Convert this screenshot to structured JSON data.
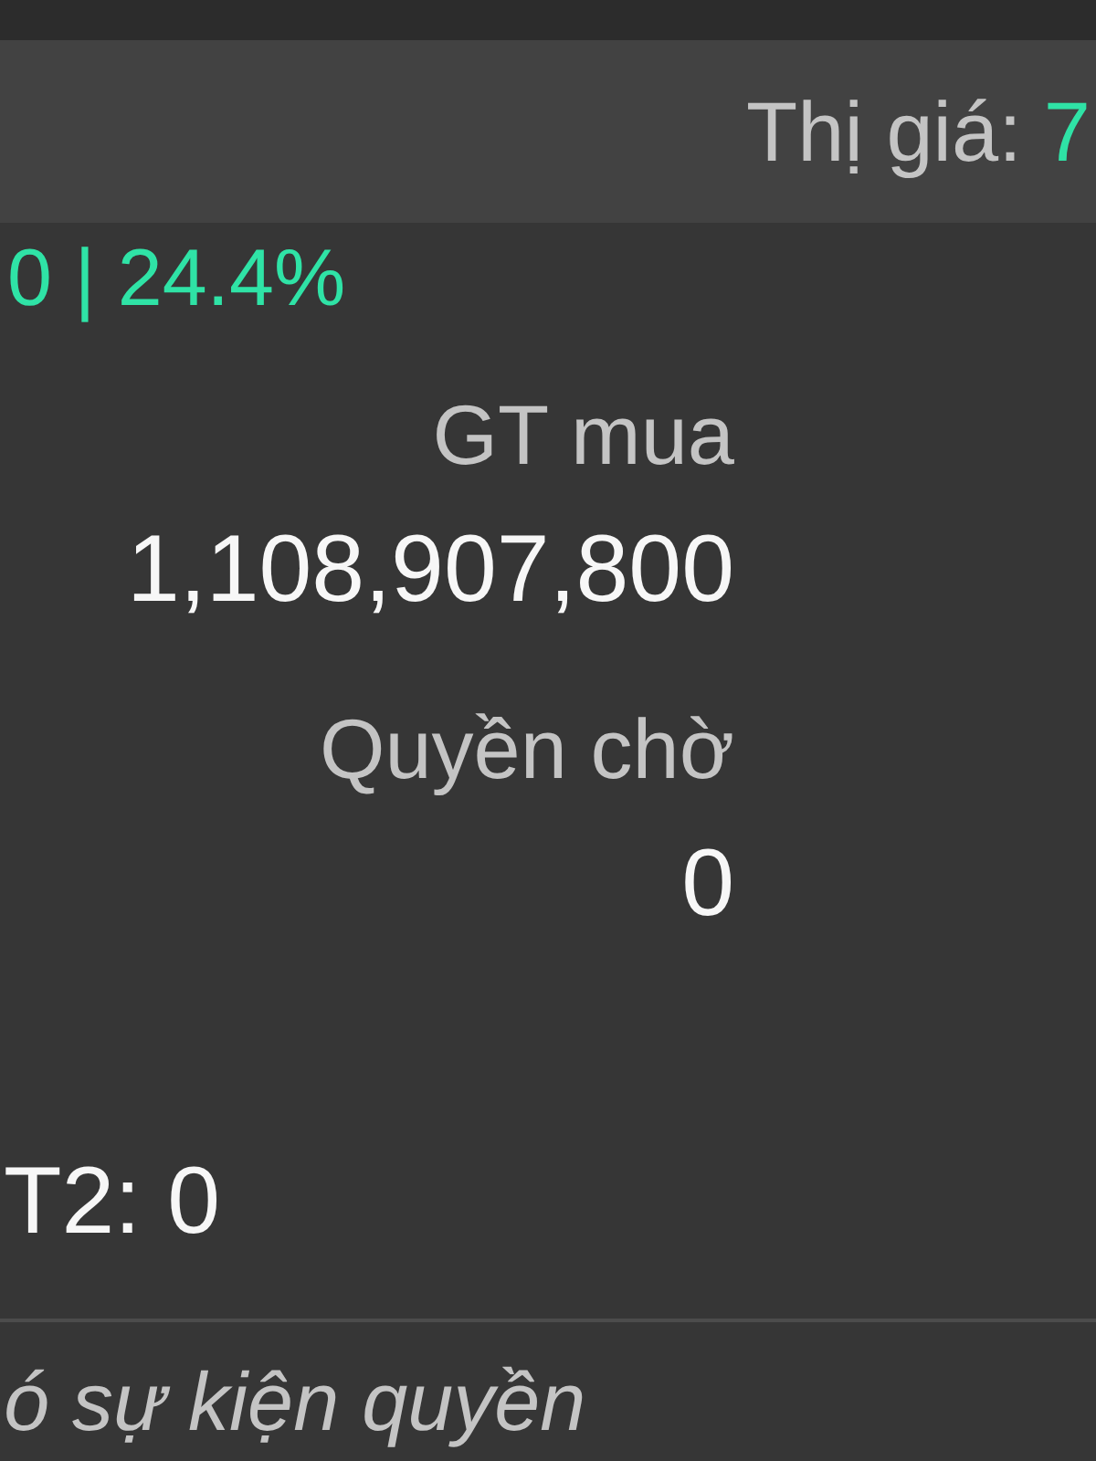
{
  "header": {
    "label": "Thị giá:",
    "value": "7"
  },
  "summary": {
    "text": "0 | 24.4%"
  },
  "stats": [
    {
      "label": "GT mua",
      "value": "1,108,907,800"
    },
    {
      "label": "Quyền chờ",
      "value": "0"
    }
  ],
  "t2_line": "T2: 0",
  "events_note": "ó sự kiện quyền"
}
